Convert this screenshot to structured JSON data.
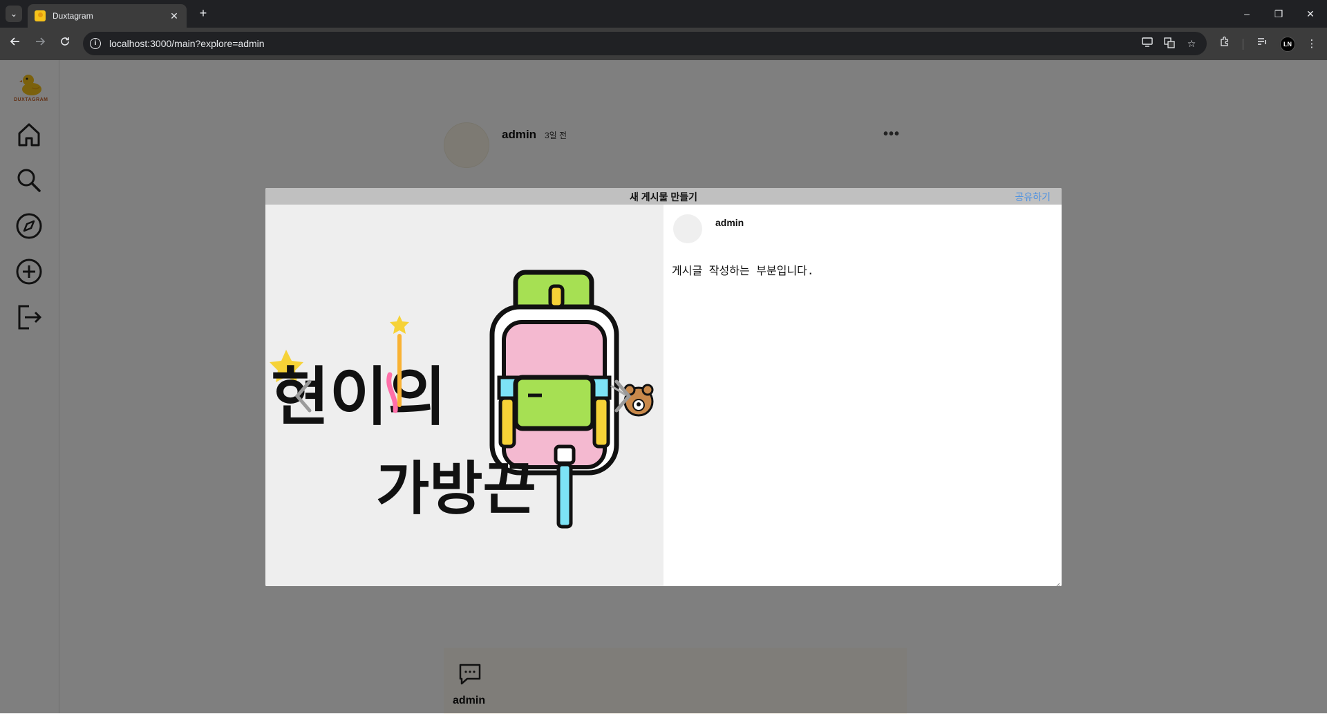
{
  "browser": {
    "tab_title": "Duxtagram",
    "url": "localhost:3000/main?explore=admin",
    "tab_close": "✕",
    "new_tab": "+",
    "window_controls": {
      "minimize": "–",
      "restore": "❐",
      "close": "✕"
    },
    "profile_initials": "LN"
  },
  "sidebar": {
    "logo_text": "DUXTAGRAM",
    "items": [
      {
        "icon": "home-icon"
      },
      {
        "icon": "search-icon"
      },
      {
        "icon": "explore-icon"
      },
      {
        "icon": "create-icon"
      },
      {
        "icon": "logout-icon"
      }
    ]
  },
  "feed": {
    "author": "admin",
    "time": "3일 전",
    "more": "•••",
    "footer_author": "admin"
  },
  "modal": {
    "title": "새 게시물 만들기",
    "share_label": "공유하기",
    "author": "admin",
    "content": "게시글 작성하는 부분입니다.",
    "image_text_line1": "현이의",
    "image_text_line2": "가방끈"
  },
  "colors": {
    "accent_link": "#4a90e2",
    "header_bar": "#c0c0c0",
    "image_bg": "#eeeeee",
    "overlay": "rgba(0,0,0,0.5)"
  }
}
